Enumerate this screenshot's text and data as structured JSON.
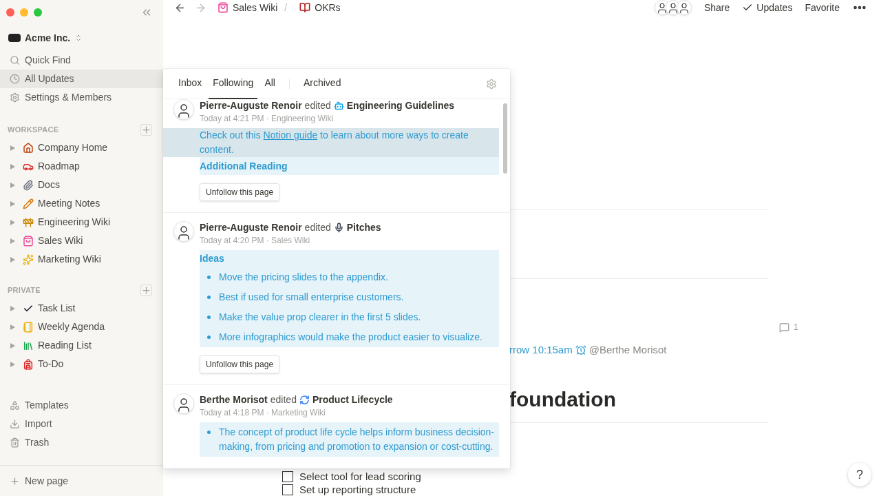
{
  "sidebar": {
    "workspace_name": "Acme Inc.",
    "nav": [
      {
        "label": "Quick Find",
        "selected": false
      },
      {
        "label": "All Updates",
        "selected": true
      },
      {
        "label": "Settings & Members",
        "selected": false
      }
    ],
    "sections": [
      {
        "title": "WORKSPACE",
        "items": [
          {
            "label": "Company Home"
          },
          {
            "label": "Roadmap"
          },
          {
            "label": "Docs"
          },
          {
            "label": "Meeting Notes"
          },
          {
            "label": "Engineering Wiki"
          },
          {
            "label": "Sales Wiki"
          },
          {
            "label": "Marketing Wiki"
          }
        ]
      },
      {
        "title": "PRIVATE",
        "items": [
          {
            "label": "Task List"
          },
          {
            "label": "Weekly Agenda"
          },
          {
            "label": "Reading List"
          },
          {
            "label": "To-Do"
          }
        ]
      }
    ],
    "tools": [
      "Templates",
      "Import",
      "Trash"
    ],
    "new_page": "New page"
  },
  "topbar": {
    "breadcrumb": [
      "Sales Wiki",
      "OKRs"
    ],
    "separator": "/",
    "actions": [
      "Share",
      "Updates",
      "Favorite"
    ]
  },
  "updates_popup": {
    "tabs": [
      {
        "label": "Inbox",
        "selected": false
      },
      {
        "label": "Following",
        "selected": true
      },
      {
        "label": "All",
        "selected": false
      },
      {
        "label": "Archived",
        "selected": false
      }
    ],
    "entries": [
      {
        "author": "Pierre-Auguste Renoir",
        "action": "edited",
        "page": "Engineering Guidelines",
        "meta": "Today at 4:21 PM · Engineering Wiki",
        "button": "Unfollow this page",
        "blocks": [
          {
            "kind": "paragraph",
            "hovered": true,
            "parts": [
              {
                "text": "Check out this ",
                "link": false
              },
              {
                "text": "Notion guide",
                "link": true
              },
              {
                "text": " to learn about more ways to create content.",
                "link": false
              }
            ]
          },
          {
            "kind": "heading",
            "hovered": false,
            "text": "Additional Reading"
          }
        ]
      },
      {
        "author": "Pierre-Auguste Renoir",
        "action": "edited",
        "page": "Pitches",
        "meta": "Today at 4:20 PM · Sales Wiki",
        "button": "Unfollow this page",
        "blocks": [
          {
            "kind": "heading",
            "hovered": false,
            "text": "Ideas"
          },
          {
            "kind": "bullet",
            "hovered": false,
            "text": "Move the pricing slides to the appendix."
          },
          {
            "kind": "bullet",
            "hovered": false,
            "text": "Best if used for small enterprise customers."
          },
          {
            "kind": "bullet",
            "hovered": false,
            "text": "Make the value prop clearer in the first 5 slides."
          },
          {
            "kind": "bullet",
            "hovered": false,
            "text": "More infographics would make the product easier to visualize."
          }
        ]
      },
      {
        "author": "Berthe Morisot",
        "action": "edited",
        "page": "Product Lifecycle",
        "meta": "Today at 4:18 PM · Marketing Wiki",
        "blocks": [
          {
            "kind": "bullet",
            "hovered": false,
            "text": "The concept of product life cycle helps inform business decision-making, from pricing and promotion to expansion or cost-cutting."
          }
        ]
      }
    ]
  },
  "page": {
    "comment_count": "1",
    "reminder": "rrow 10:15am",
    "mention": "@Berthe Morisot",
    "heading": "foundation",
    "todos": [
      {
        "label": "Select tool for lead scoring",
        "checked": false
      },
      {
        "label": "Set up reporting structure",
        "checked": false
      }
    ]
  },
  "help": "?"
}
